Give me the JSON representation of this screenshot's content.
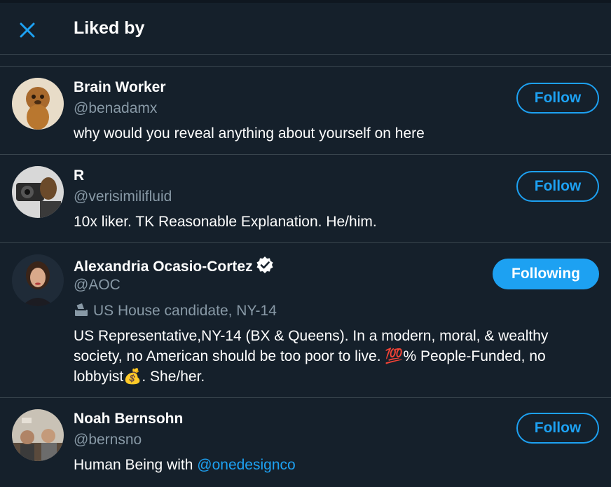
{
  "header": {
    "title": "Liked by"
  },
  "users": [
    {
      "name": "Brain Worker",
      "handle": "@benadamx",
      "bio": "why would you reveal anything about yourself on here",
      "button": "Follow"
    },
    {
      "name": "R",
      "handle": "@verisimilifluid",
      "bio": "10x liker. TK Reasonable Explanation. He/him.",
      "button": "Follow"
    },
    {
      "name": "Alexandria Ocasio-Cortez",
      "handle": "@AOC",
      "verified": true,
      "location_label": "US House candidate, NY-14",
      "bio_part1": "US Representative,NY-14 (BX & Queens). In a modern, moral, & wealthy society, no American should be too poor to live. ",
      "bio_emoji1": "💯",
      "bio_part2": "% People-Funded, no lobbyist",
      "bio_emoji2": "💰",
      "bio_part3": ". She/her.",
      "button": "Following"
    },
    {
      "name": "Noah Bernsohn",
      "handle": "@bernsno",
      "bio_text": "Human Being with ",
      "bio_link": "@onedesignco",
      "button": "Follow"
    }
  ],
  "colors": {
    "background": "#15202b",
    "accent": "#1da1f2",
    "secondary_text": "#8899a6",
    "divider": "#38444d"
  },
  "icons": [
    "close-icon",
    "verified-badge-icon",
    "ballot-box-icon"
  ]
}
